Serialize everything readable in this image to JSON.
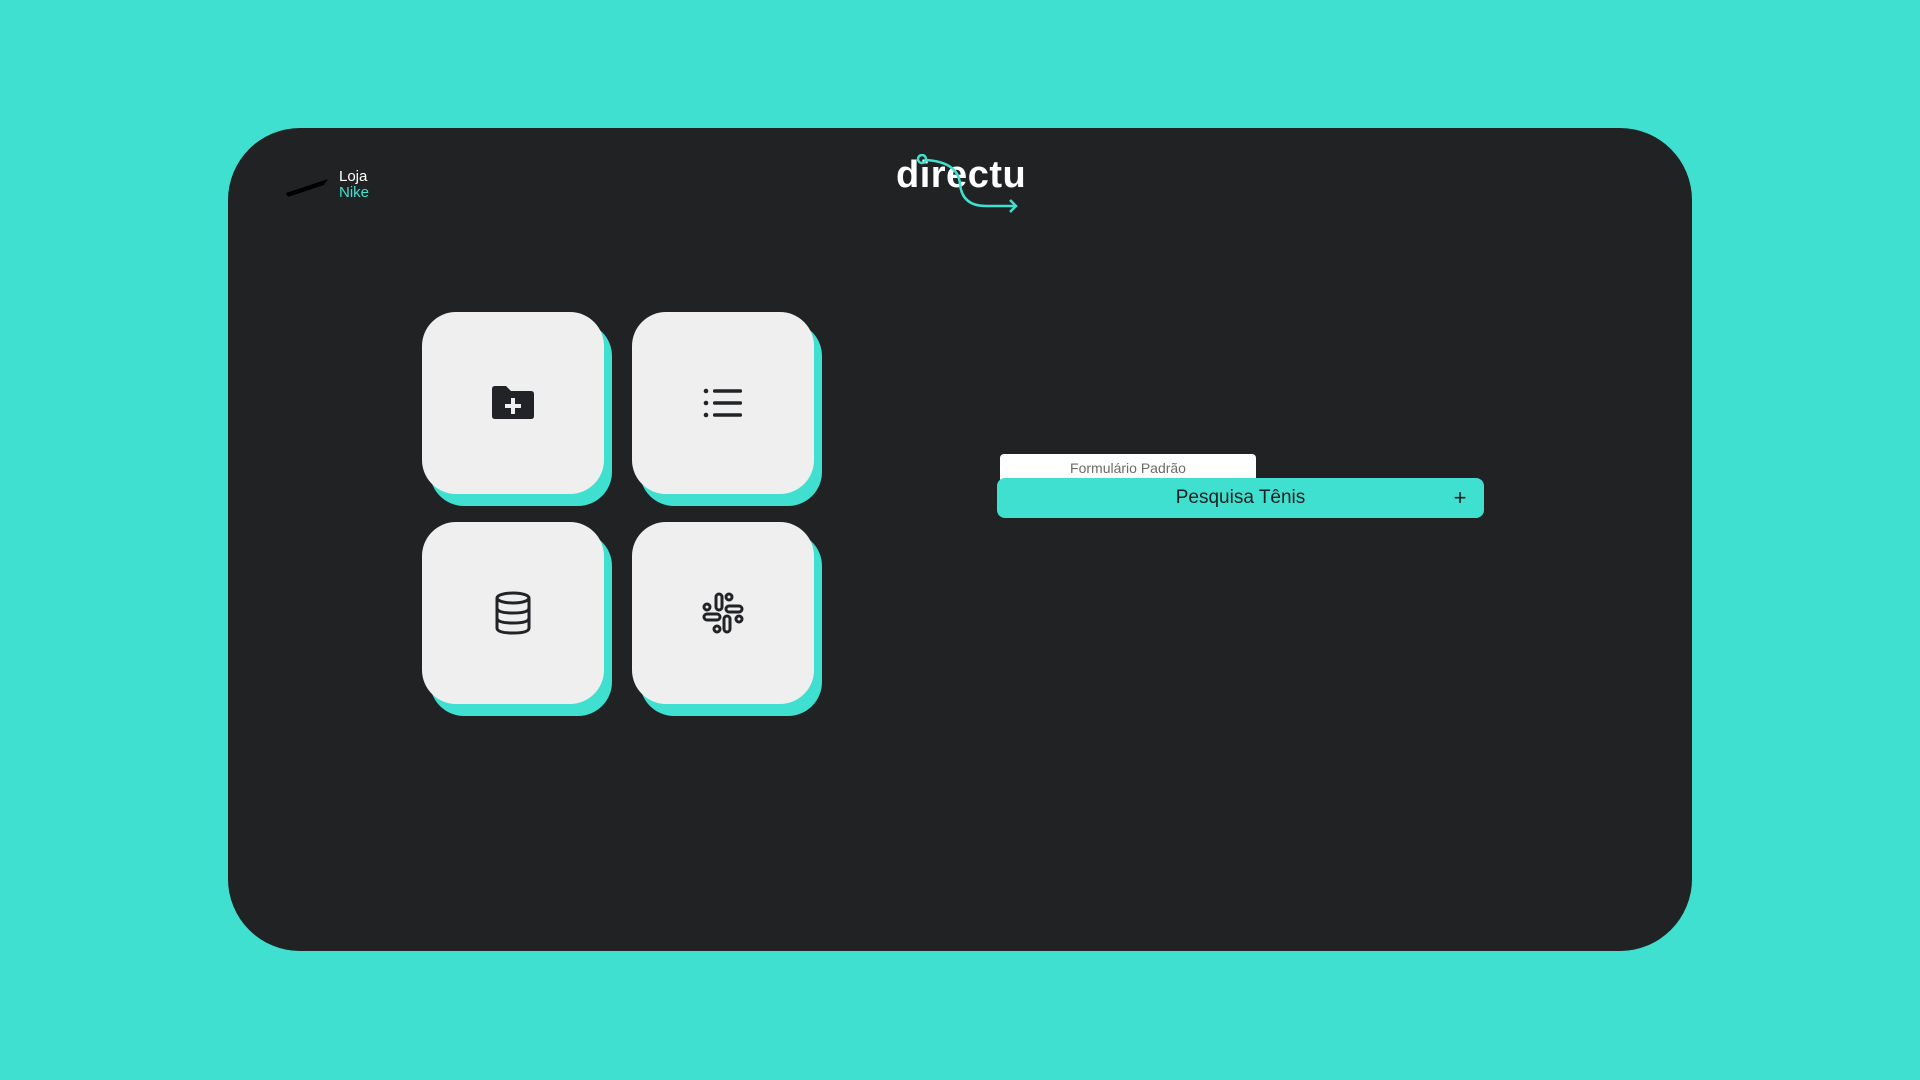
{
  "colors": {
    "background": "#3fe0d0",
    "panel": "#212224",
    "accent": "#3fe0d0",
    "tile": "#efefef",
    "icon": "#222326"
  },
  "store": {
    "logo_icon": "swoosh-logo",
    "line1": "Loja",
    "line2": "Nike"
  },
  "brand": {
    "name": "directu"
  },
  "tiles": [
    {
      "icon": "folder-plus-icon"
    },
    {
      "icon": "list-icon"
    },
    {
      "icon": "database-icon"
    },
    {
      "icon": "slack-icon"
    }
  ],
  "form": {
    "tab_label": "Formulário Padrão",
    "title": "Pesquisa Tênis",
    "action_symbol": "+"
  }
}
